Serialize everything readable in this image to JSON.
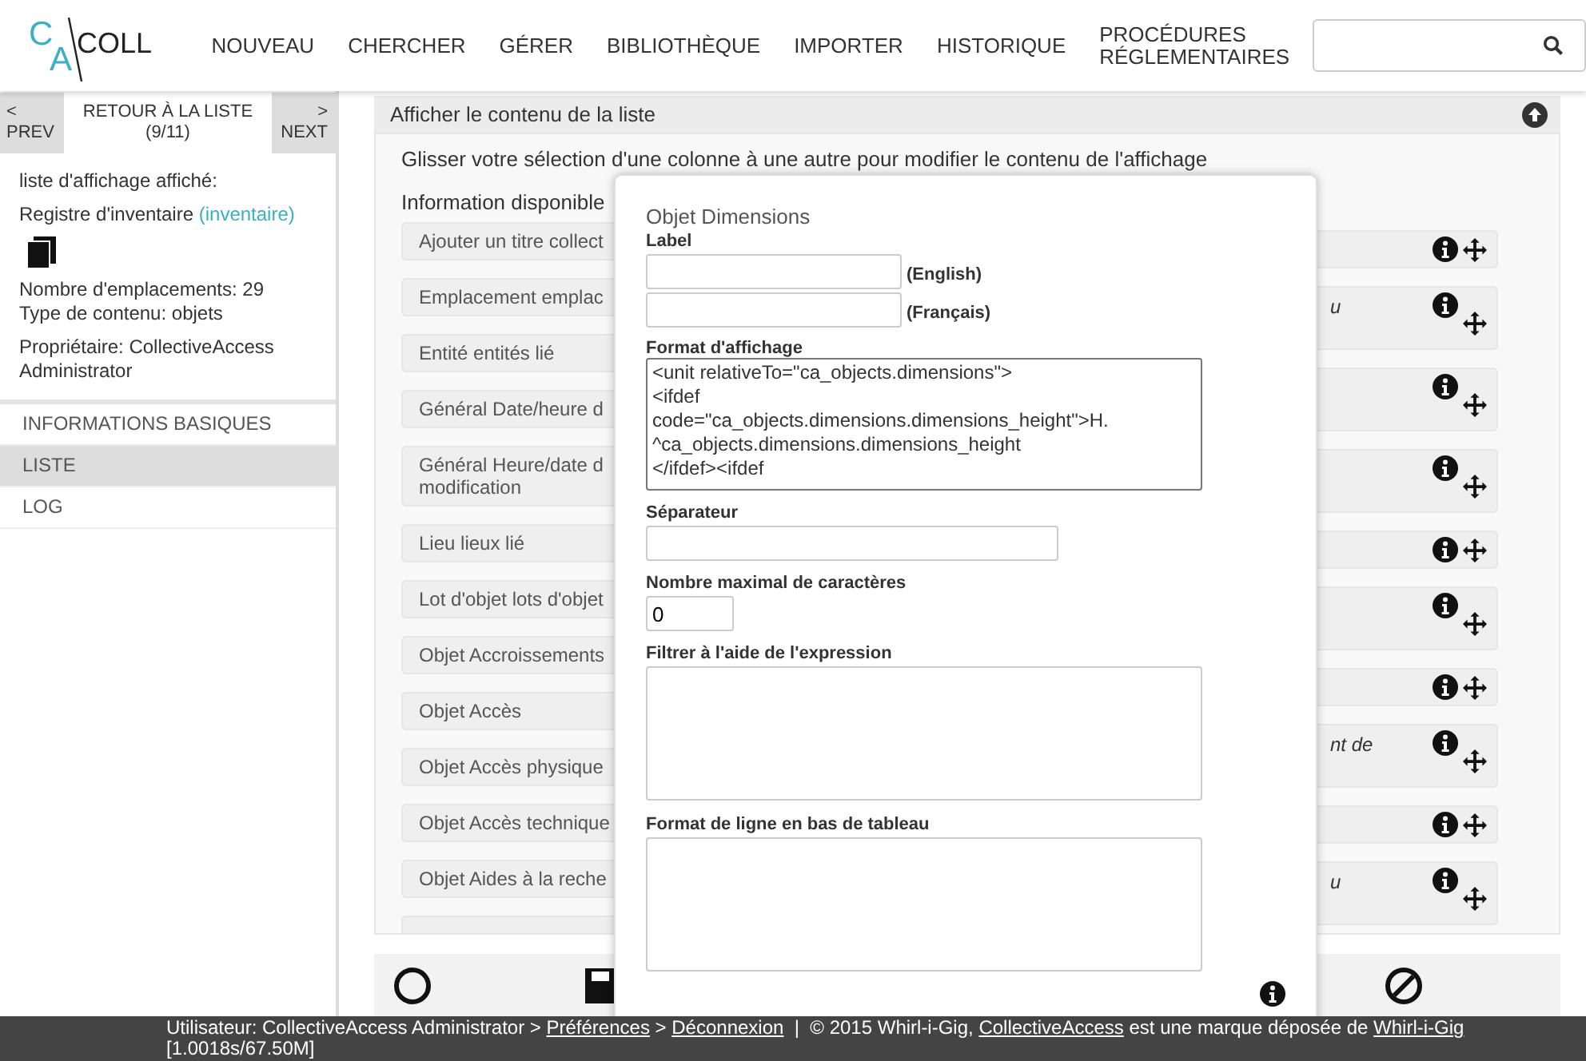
{
  "header": {
    "logo": {
      "top_letter": "C",
      "bottom_letter": "A",
      "word": "COLL"
    },
    "nav": [
      {
        "label": "NOUVEAU"
      },
      {
        "label": "CHERCHER"
      },
      {
        "label": "GÉRER"
      },
      {
        "label": "BIBLIOTHÈQUE"
      },
      {
        "label": "IMPORTER"
      },
      {
        "label": "HISTORIQUE"
      },
      {
        "label": "PROCÉDURES RÉGLEMENTAIRES"
      }
    ]
  },
  "sidebar": {
    "prev": {
      "arrow": "<",
      "label": "PREV"
    },
    "back": {
      "label": "RETOUR À LA LISTE",
      "count": "(9/11)"
    },
    "next": {
      "arrow": ">",
      "label": "NEXT"
    },
    "info_heading": "liste d'affichage affiché:",
    "list_name": "Registre d'inventaire",
    "list_code": "(inventaire)",
    "details": [
      "Nombre d'emplacements: 29",
      "Type de contenu: objets"
    ],
    "owner": "Propriétaire: CollectiveAccess Administrator",
    "menu": [
      {
        "label": "INFORMATIONS BASIQUES",
        "selected": false
      },
      {
        "label": "LISTE",
        "selected": true
      },
      {
        "label": "LOG",
        "selected": false
      }
    ]
  },
  "panel": {
    "title": "Afficher le contenu de la liste",
    "instructions": "Glisser votre sélection d'une colonne à une autre pour modifier le contenu de l'affichage",
    "available_heading": "Information disponible",
    "available": [
      {
        "text": "Ajouter un titre collect"
      },
      {
        "text": "Emplacement emplac"
      },
      {
        "text": "Entité entités lié"
      },
      {
        "text": "Général Date/heure d"
      },
      {
        "text": "Général Heure/date d modification"
      },
      {
        "text": "Lieu lieux lié"
      },
      {
        "text": "Lot d'objet lots d'objet"
      },
      {
        "text": "Objet Accroissements"
      },
      {
        "text": "Objet Accès"
      },
      {
        "text": "Objet Accès physique"
      },
      {
        "text": "Objet Accès technique"
      },
      {
        "text": "Objet Aides à la reche"
      }
    ],
    "selected_columns": [
      {
        "kind": "single"
      },
      {
        "kind": "double",
        "text": "u"
      },
      {
        "kind": "double"
      },
      {
        "kind": "double"
      },
      {
        "kind": "single"
      },
      {
        "kind": "double"
      },
      {
        "kind": "single"
      },
      {
        "kind": "double",
        "text": "nt de"
      },
      {
        "kind": "single"
      },
      {
        "kind": "double",
        "text": "u"
      }
    ]
  },
  "dialog": {
    "title": "Objet Dimensions",
    "label_heading": "Label",
    "languages": [
      "(English)",
      "(Français)"
    ],
    "format_heading": "Format d'affichage",
    "format_value": "<unit relativeTo=\"ca_objects.dimensions\">\n<ifdef\ncode=\"ca_objects.dimensions.dimensions_height\">H.\n^ca_objects.dimensions.dimensions_height\n</ifdef><ifdef",
    "separator_heading": "Séparateur",
    "max_chars_heading": "Nombre maximal de caractères",
    "max_chars_value": "0",
    "filter_heading": "Filtrer à l'aide de l'expression",
    "footer_format_heading": "Format de ligne en bas de tableau"
  },
  "footer": {
    "parts": [
      {
        "kind": "text",
        "text": "Utilisateur: CollectiveAccess Administrator > "
      },
      {
        "kind": "link",
        "text": "Préférences"
      },
      {
        "kind": "text",
        "text": " > "
      },
      {
        "kind": "link",
        "text": "Déconnexion"
      },
      {
        "kind": "text",
        "text": "  |  © 2015 Whirl-i-Gig, "
      },
      {
        "kind": "link",
        "text": "CollectiveAccess"
      },
      {
        "kind": "text",
        "text": " est une marque déposée de "
      },
      {
        "kind": "link",
        "text": "Whirl-i-Gig"
      }
    ],
    "timing": "[1.0018s/67.50M]"
  }
}
